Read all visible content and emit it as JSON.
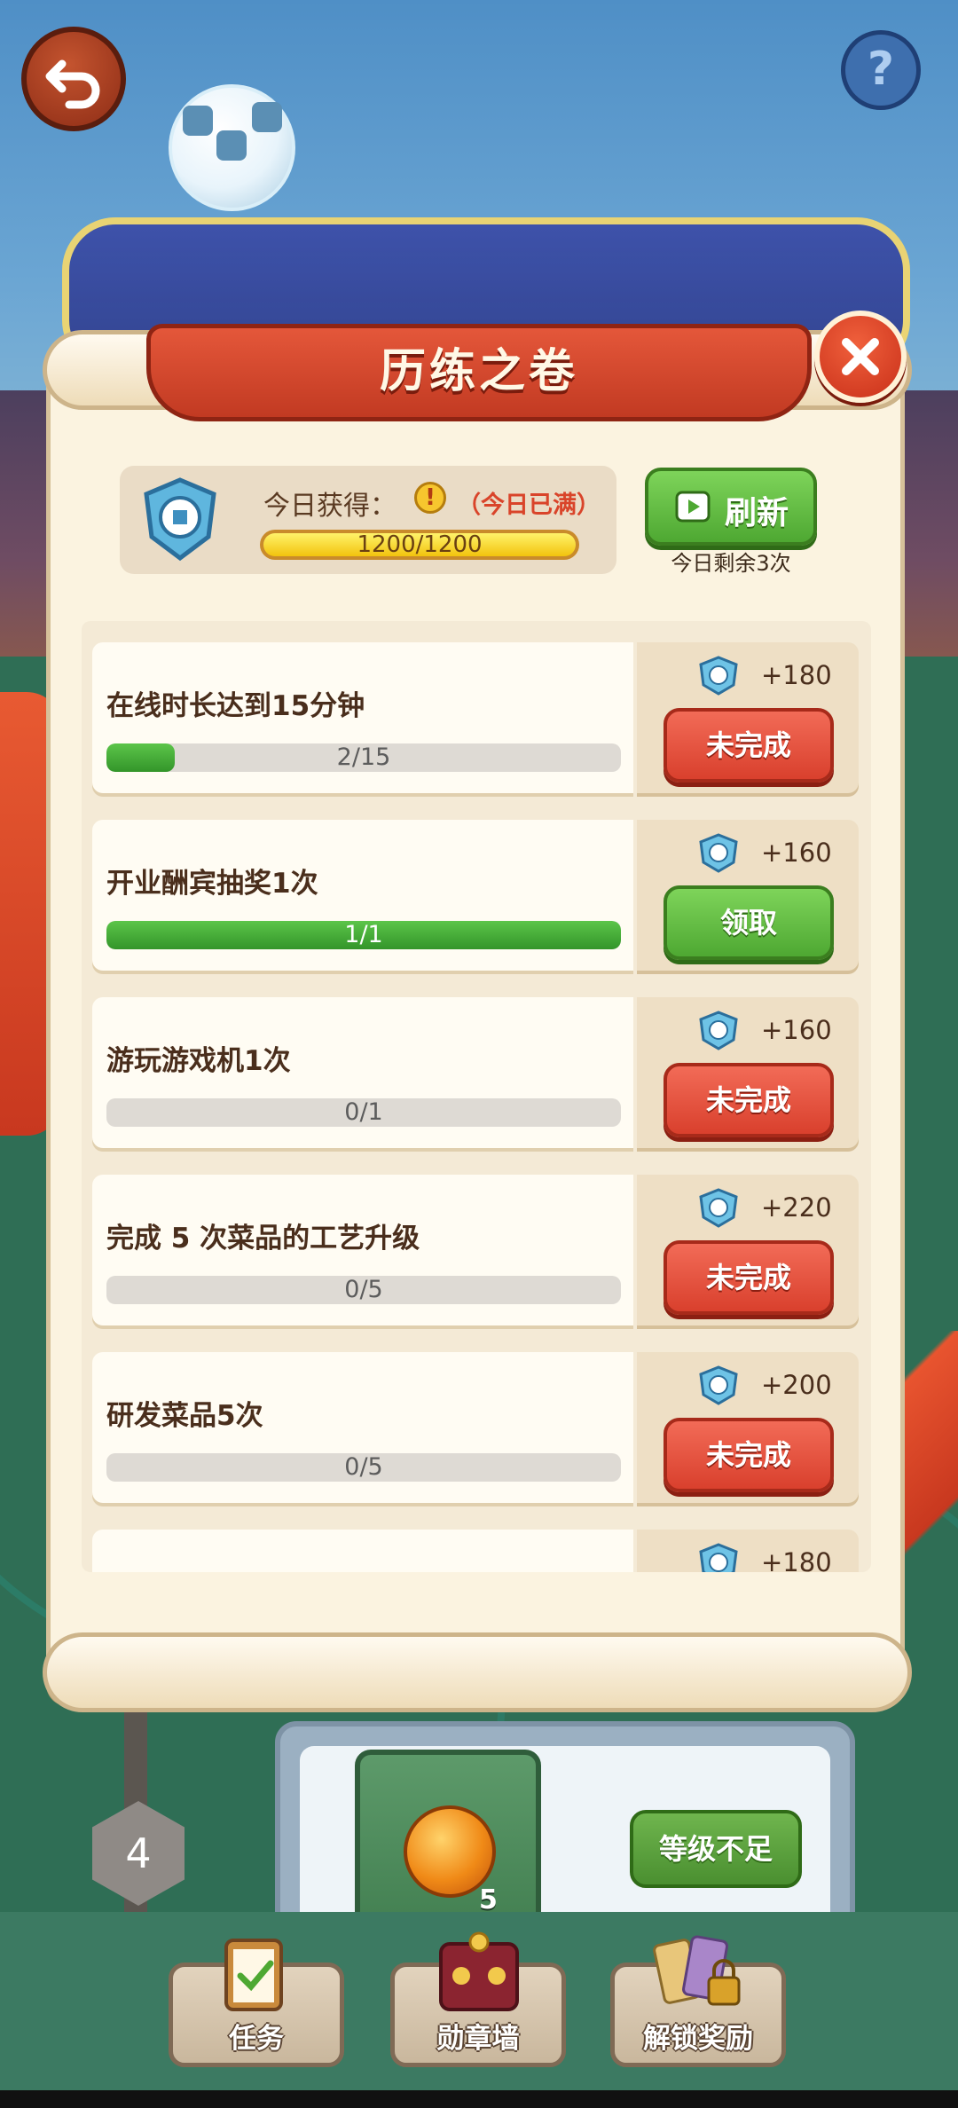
{
  "header": {
    "title": "历练之卷"
  },
  "summary": {
    "label": "今日获得：",
    "warning_icon": "!",
    "status": "（今日已满）",
    "progress_text": "1200/1200",
    "progress_fraction": 1.0
  },
  "refresh": {
    "label": "刷新",
    "remaining": "今日剩余3次"
  },
  "tasks": [
    {
      "title": "在线时长达到15分钟",
      "progress_text": "2/15",
      "progress_fraction": 0.1333,
      "reward": "+180",
      "button": "未完成",
      "button_state": "incomplete"
    },
    {
      "title": "开业酬宾抽奖1次",
      "progress_text": "1/1",
      "progress_fraction": 1.0,
      "reward": "+160",
      "button": "领取",
      "button_state": "claim"
    },
    {
      "title": "游玩游戏机1次",
      "progress_text": "0/1",
      "progress_fraction": 0,
      "reward": "+160",
      "button": "未完成",
      "button_state": "incomplete"
    },
    {
      "title": "完成 5 次菜品的工艺升级",
      "progress_text": "0/5",
      "progress_fraction": 0,
      "reward": "+220",
      "button": "未完成",
      "button_state": "incomplete"
    },
    {
      "title": "研发菜品5次",
      "progress_text": "0/5",
      "progress_fraction": 0,
      "reward": "+200",
      "button": "未完成",
      "button_state": "incomplete"
    },
    {
      "title": "",
      "progress_text": "",
      "progress_fraction": 0,
      "reward": "+180",
      "button": "",
      "button_state": "incomplete"
    }
  ],
  "level": {
    "current": "4",
    "reward_count": "5",
    "button": "等级不足"
  },
  "bottom_tabs": [
    {
      "label": "任务",
      "icon": "clipboard-icon"
    },
    {
      "label": "勋章墙",
      "icon": "medal-wall-icon"
    },
    {
      "label": "解锁奖励",
      "icon": "lock-cards-icon"
    }
  ],
  "colors": {
    "button_red": "#d9402d",
    "button_green": "#4ea832",
    "banner_red": "#c23a22",
    "progress_green": "#33952a",
    "progress_gold": "#f2c30d"
  }
}
